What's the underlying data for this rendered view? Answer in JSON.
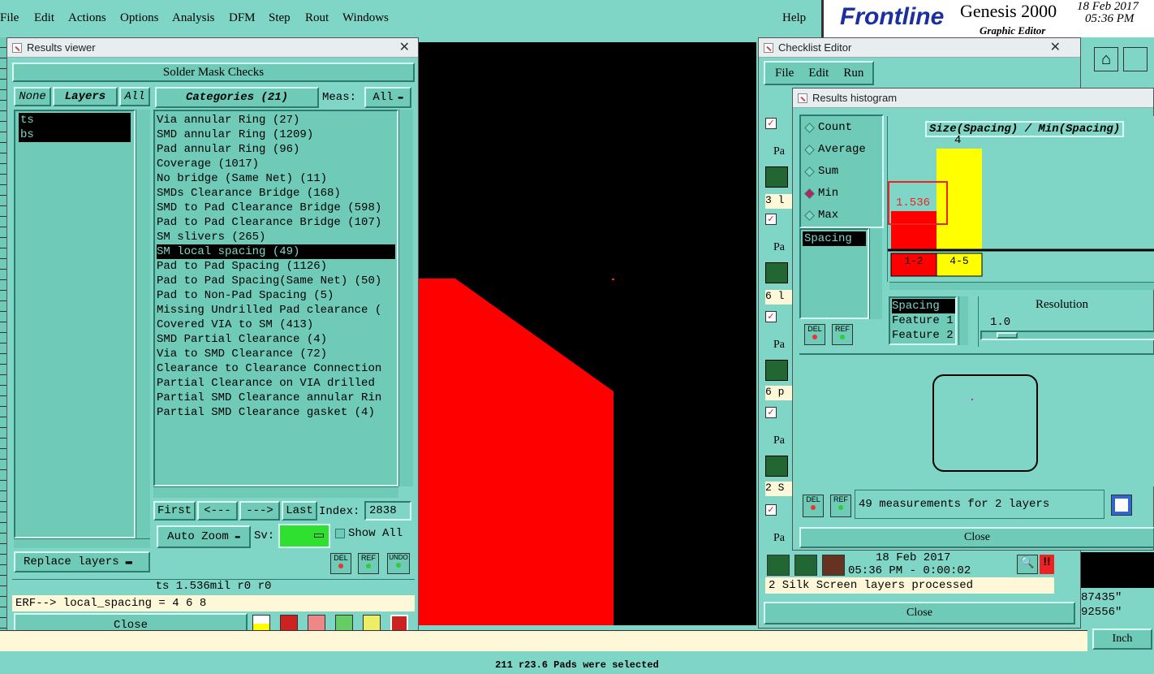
{
  "menubar": {
    "items": [
      "File",
      "Edit",
      "Actions",
      "Options",
      "Analysis",
      "DFM",
      "Step",
      "Rout",
      "Windows"
    ],
    "help": "Help"
  },
  "brand": {
    "logo": "Frontline",
    "product": "Genesis 2000",
    "subtitle": "Graphic Editor",
    "date": "18 Feb 2017",
    "time": "05:36 PM"
  },
  "results_viewer": {
    "title": "Results viewer",
    "header": "Solder Mask Checks",
    "none_btn": "None",
    "layers_btn": "Layers",
    "all_btn": "All",
    "categories_btn": "Categories (21)",
    "meas_label": "Meas:",
    "meas_value": "All",
    "layers": [
      "ts",
      "bs"
    ],
    "categories": [
      "Via annular Ring (27)",
      "SMD annular Ring (1209)",
      "Pad annular Ring (96)",
      "Coverage (1017)",
      "No bridge (Same Net) (11)",
      "SMDs Clearance Bridge (168)",
      "SMD to Pad Clearance Bridge (598)",
      "Pad to Pad Clearance Bridge (107)",
      "SM slivers (265)",
      "SM local spacing (49)",
      "Pad to Pad Spacing (1126)",
      "Pad to Pad Spacing(Same Net) (50)",
      "Pad to Non-Pad Spacing (5)",
      "Missing Undrilled Pad clearance (",
      "Covered VIA to SM (413)",
      "SMD Partial Clearance (4)",
      "Via to SMD Clearance (72)",
      "Clearance to Clearance Connection",
      "Partial Clearance on VIA drilled",
      "Partial SMD Clearance annular Rin",
      "Partial SMD Clearance gasket (4)"
    ],
    "selected_index": 9,
    "first": "First",
    "prev": "<---",
    "next": "--->",
    "last": "Last",
    "index_label": "Index:",
    "index_value": "2838",
    "auto_zoom": "Auto Zoom",
    "sv_label": "Sv:",
    "show_all": "Show All",
    "replace_layers": "Replace layers",
    "del": "DEL",
    "ref": "REF",
    "undo": "UNDO",
    "status": "ts 1.536mil  r0  r0",
    "erf": "ERF--> local_spacing = 4 6 8",
    "close": "Close"
  },
  "checklist_editor": {
    "title": "Checklist Editor",
    "menu": [
      "File",
      "Edit",
      "Run"
    ],
    "rows": [
      "3 l",
      "6 l",
      "6 p",
      "2 S"
    ],
    "pa": "Pa",
    "date": "18 Feb 2017",
    "time": "05:36 PM - 0:00:02",
    "status": "2 Silk Screen layers processed",
    "close": "Close"
  },
  "histogram": {
    "title": "Results histogram",
    "modes": [
      "Count",
      "Average",
      "Sum",
      "Min",
      "Max"
    ],
    "selected_mode": "Min",
    "chart_title": "Size(Spacing) / Min(Spacing)",
    "list_item": "Spacing",
    "bars": [
      {
        "label": "1-2",
        "value": "1.536",
        "color": "#ff0000"
      },
      {
        "label": "4-5",
        "value": "4",
        "color": "#ffff00"
      }
    ],
    "feature_list": [
      "Spacing",
      "Feature 1",
      "Feature 2"
    ],
    "resolution_label": "Resolution",
    "resolution_value": "1.0",
    "measurements": "49 measurements for 2 layers",
    "close": "Close",
    "del": "DEL",
    "ref": "REF"
  },
  "right_panel": {
    "coord1": "87435\"",
    "coord2": "92556\"",
    "unit": "Inch"
  },
  "statusbar": {
    "text": "211 r23.6 Pads were selected"
  }
}
